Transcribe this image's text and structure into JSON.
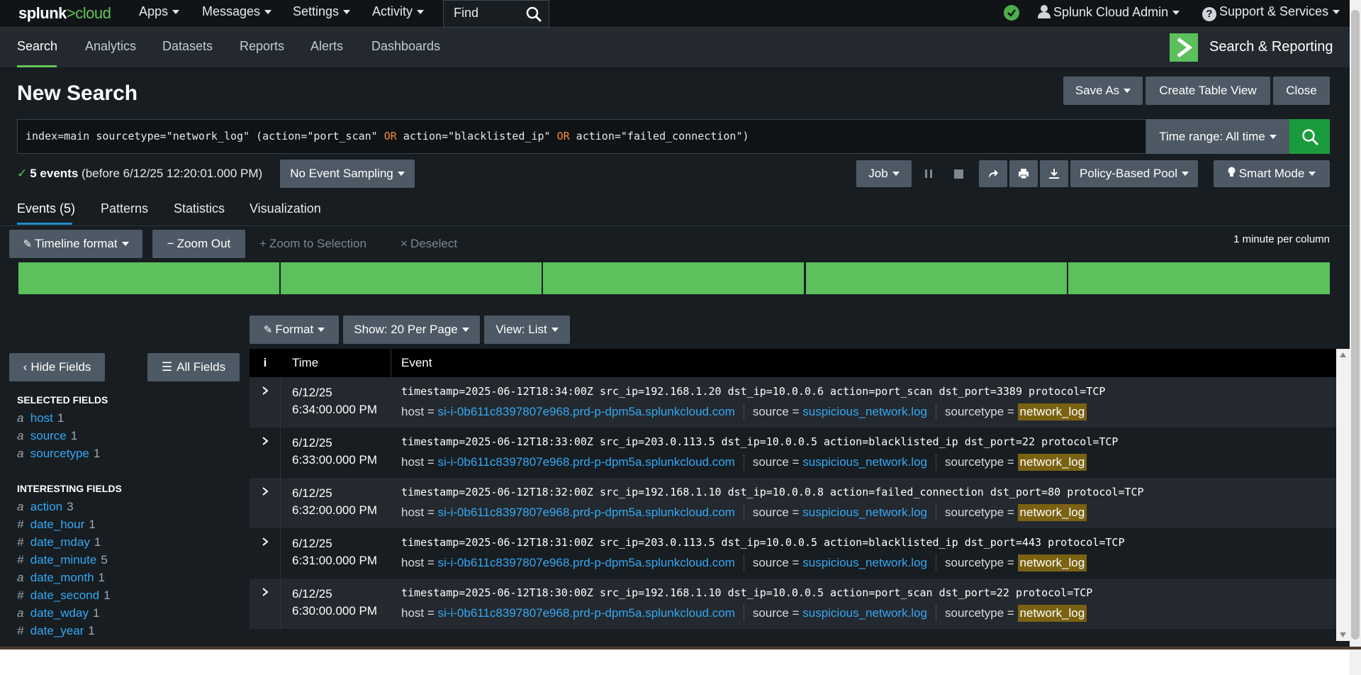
{
  "topbar": {
    "logo_splunk": "splunk",
    "logo_gt": ">",
    "logo_cloud": "cloud",
    "menus": [
      "Apps",
      "Messages",
      "Settings",
      "Activity"
    ],
    "find_label": "Find",
    "user": "Splunk Cloud Admin",
    "support": "Support & Services"
  },
  "appbar": {
    "tabs": [
      "Search",
      "Analytics",
      "Datasets",
      "Reports",
      "Alerts",
      "Dashboards"
    ],
    "active_tab": "Search",
    "app_title": "Search & Reporting"
  },
  "page": {
    "title": "New Search",
    "save_as": "Save As",
    "create_table_view": "Create Table View",
    "close": "Close"
  },
  "search": {
    "query_part1": "index=main sourcetype=\"network_log\" (action=\"port_scan\" ",
    "or1": "OR",
    "query_part2": " action=\"blacklisted_ip\" ",
    "or2": "OR",
    "query_part3": " action=\"failed_connection\")",
    "time_range": "Time range: All time"
  },
  "status": {
    "count": "5 events",
    "before": "(before 6/12/25 12:20:01.000 PM)",
    "sampling": "No Event Sampling",
    "job": "Job",
    "pool": "Policy-Based Pool",
    "mode": "Smart Mode"
  },
  "result_tabs": [
    "Events (5)",
    "Patterns",
    "Statistics",
    "Visualization"
  ],
  "timeline": {
    "format": "Timeline format",
    "zoom_out": "Zoom Out",
    "zoom_selection": "Zoom to Selection",
    "deselect": "Deselect",
    "scale": "1 minute per column",
    "columns": 5
  },
  "event_controls": {
    "format": "Format",
    "show": "Show: 20 Per Page",
    "view": "View: List"
  },
  "fields": {
    "hide": "Hide Fields",
    "all": "All Fields",
    "selected_heading": "SELECTED FIELDS",
    "selected": [
      {
        "type": "a",
        "name": "host",
        "count": "1"
      },
      {
        "type": "a",
        "name": "source",
        "count": "1"
      },
      {
        "type": "a",
        "name": "sourcetype",
        "count": "1"
      }
    ],
    "interesting_heading": "INTERESTING FIELDS",
    "interesting": [
      {
        "type": "a",
        "name": "action",
        "count": "3"
      },
      {
        "type": "#",
        "name": "date_hour",
        "count": "1"
      },
      {
        "type": "#",
        "name": "date_mday",
        "count": "1"
      },
      {
        "type": "#",
        "name": "date_minute",
        "count": "5"
      },
      {
        "type": "a",
        "name": "date_month",
        "count": "1"
      },
      {
        "type": "#",
        "name": "date_second",
        "count": "1"
      },
      {
        "type": "a",
        "name": "date_wday",
        "count": "1"
      },
      {
        "type": "#",
        "name": "date_year",
        "count": "1"
      }
    ]
  },
  "table": {
    "col_info": "i",
    "col_time": "Time",
    "col_event": "Event",
    "host_label": "host =",
    "source_label": "source =",
    "sourcetype_label": "sourcetype =",
    "events": [
      {
        "date": "6/12/25",
        "time": "6:34:00.000 PM",
        "raw": "timestamp=2025-06-12T18:34:00Z src_ip=192.168.1.20 dst_ip=10.0.0.6 action=port_scan dst_port=3389 protocol=TCP",
        "host": "si-i-0b611c8397807e968.prd-p-dpm5a.splunkcloud.com",
        "source": "suspicious_network.log",
        "sourcetype": "network_log"
      },
      {
        "date": "6/12/25",
        "time": "6:33:00.000 PM",
        "raw": "timestamp=2025-06-12T18:33:00Z src_ip=203.0.113.5 dst_ip=10.0.0.5 action=blacklisted_ip dst_port=22 protocol=TCP",
        "host": "si-i-0b611c8397807e968.prd-p-dpm5a.splunkcloud.com",
        "source": "suspicious_network.log",
        "sourcetype": "network_log"
      },
      {
        "date": "6/12/25",
        "time": "6:32:00.000 PM",
        "raw": "timestamp=2025-06-12T18:32:00Z src_ip=192.168.1.10 dst_ip=10.0.0.8 action=failed_connection dst_port=80 protocol=TCP",
        "host": "si-i-0b611c8397807e968.prd-p-dpm5a.splunkcloud.com",
        "source": "suspicious_network.log",
        "sourcetype": "network_log"
      },
      {
        "date": "6/12/25",
        "time": "6:31:00.000 PM",
        "raw": "timestamp=2025-06-12T18:31:00Z src_ip=203.0.113.5 dst_ip=10.0.0.5 action=blacklisted_ip dst_port=443 protocol=TCP",
        "host": "si-i-0b611c8397807e968.prd-p-dpm5a.splunkcloud.com",
        "source": "suspicious_network.log",
        "sourcetype": "network_log"
      },
      {
        "date": "6/12/25",
        "time": "6:30:00.000 PM",
        "raw": "timestamp=2025-06-12T18:30:00Z src_ip=192.168.1.10 dst_ip=10.0.0.5 action=port_scan dst_port=22 protocol=TCP",
        "host": "si-i-0b611c8397807e968.prd-p-dpm5a.splunkcloud.com",
        "source": "suspicious_network.log",
        "sourcetype": "network_log"
      }
    ]
  },
  "colors": {
    "background": "#171d21",
    "accent_green": "#65c35a",
    "timeline_green": "#5cc05c",
    "link_blue": "#37a7f2",
    "highlight": "#7a6212",
    "search_green": "#1a9c3e"
  }
}
